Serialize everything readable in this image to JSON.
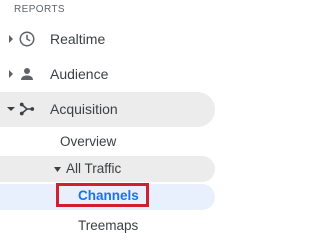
{
  "section": {
    "label": "REPORTS"
  },
  "nav": {
    "realtime": {
      "label": "Realtime",
      "icon": "clock-icon",
      "expanded": false
    },
    "audience": {
      "label": "Audience",
      "icon": "person-icon",
      "expanded": false
    },
    "acquisition": {
      "label": "Acquisition",
      "icon": "acquisition-icon",
      "expanded": true,
      "children": {
        "overview": {
          "label": "Overview"
        },
        "all_traffic": {
          "label": "All Traffic",
          "expanded": true,
          "children": {
            "channels": {
              "label": "Channels",
              "selected": true
            },
            "treemaps": {
              "label": "Treemaps"
            }
          }
        }
      }
    }
  },
  "colors": {
    "text": "#3c4043",
    "muted": "#5f6368",
    "selected_text": "#1a73e8",
    "selected_bg": "#e8f0fe",
    "expanded_bg": "#ececec",
    "highlight_border": "#d21f2d"
  }
}
